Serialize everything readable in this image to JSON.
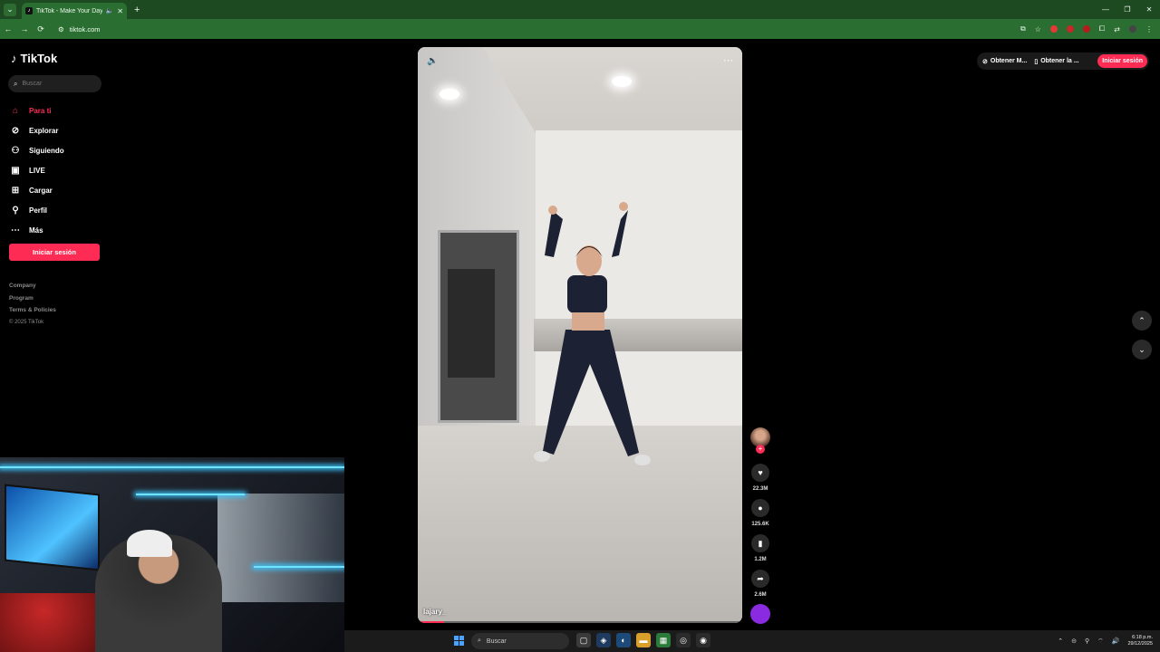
{
  "browser": {
    "tab_title": "TikTok - Make Your Day",
    "url": "tiktok.com"
  },
  "sidebar": {
    "logo": "TikTok",
    "search_placeholder": "Buscar",
    "items": [
      {
        "label": "Para ti",
        "icon": "home-icon",
        "active": true
      },
      {
        "label": "Explorar",
        "icon": "compass-icon",
        "active": false
      },
      {
        "label": "Siguiendo",
        "icon": "following-icon",
        "active": false
      },
      {
        "label": "LIVE",
        "icon": "live-icon",
        "active": false
      },
      {
        "label": "Cargar",
        "icon": "upload-icon",
        "active": false
      },
      {
        "label": "Perfil",
        "icon": "profile-icon",
        "active": false
      },
      {
        "label": "Más",
        "icon": "more-dots-icon",
        "active": false
      }
    ],
    "login_button": "Iniciar sesión",
    "footer": {
      "company": "Company",
      "program": "Program",
      "terms": "Terms & Policies",
      "copyright": "© 2025 TikTok"
    }
  },
  "video": {
    "username": "lajary_",
    "progress": 0.08
  },
  "actions": {
    "likes": "22.3M",
    "comments": "125.6K",
    "saves": "1.2M",
    "shares": "2.6M"
  },
  "topright": {
    "pill1": "Obtener M...",
    "pill2": "Obtener la ...",
    "login": "Iniciar sesión"
  },
  "taskbar": {
    "search": "Buscar",
    "time": "6:18 p.m.",
    "date": "29/12/2025"
  },
  "colors": {
    "brand": "#fe2c55",
    "chrome": "#2b6e31"
  }
}
